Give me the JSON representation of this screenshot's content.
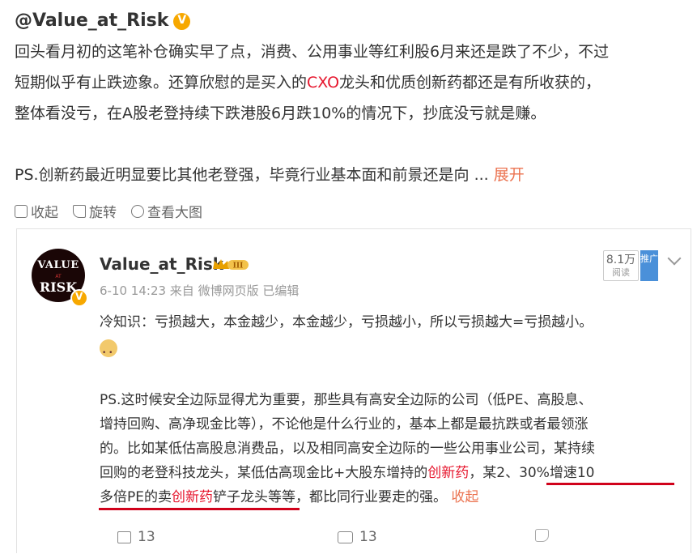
{
  "post": {
    "author": "@Value_at_Risk",
    "lines": {
      "l1": "回头看月初的这笔补仓确实早了点，消费、公用事业等红利股6月来还是跌了不少，不过",
      "l2a": "短期似乎有止跌迹象。还算欣慰的是买入的",
      "l2red": "CXO",
      "l2b": "龙头和优质创新药都还是有所收获的，",
      "l3": "整体看没亏，在A股老登持续下跌港股6月跌10%的情况下，抄底没亏就是赚。",
      "l4": "PS.创新药最近明显要比其他老登强，毕竟行业基本面和前景还是向 ... ",
      "expand": "展开"
    },
    "actions": {
      "collect": "收起",
      "rotate": "旋转",
      "view_large": "查看大图"
    }
  },
  "card": {
    "avatar_text_top": "VALUE",
    "avatar_text_mid": "AT",
    "avatar_text_bottom": "RISK",
    "author": "Value_at_Risk",
    "meta": "6-10 14:23  来自 微博网页版 已编辑",
    "read_count": "8.1万",
    "read_label": "阅读",
    "promote": "推广",
    "text": {
      "c1": "冷知识：亏损越大，本金越少，本金越少，亏损越小，所以亏损越大=亏损越小。",
      "c2": "PS.这时候安全边际显得尤为重要，那些具有高安全边际的公司（低PE、高股息、",
      "c3": "增持回购、高净现金比等），不论他是什么行业的，基本上都是最抗跌或者最领涨",
      "c4": "的。比如某低估高股息消费品，以及相同高安全边际的一些公用事业公司，某持续",
      "c5a": "回购的老登科技龙头，某低估高现金比+大股东增持的",
      "c5red": "创新药",
      "c5b": "，某2、30%增速10",
      "c6a": "多倍PE的卖",
      "c6red": "创新药",
      "c6b": "铲子龙头等等，都比同行业要走的强。",
      "collapse": "收起"
    },
    "actions": {
      "share_count": "13",
      "comment_count": "13"
    }
  }
}
